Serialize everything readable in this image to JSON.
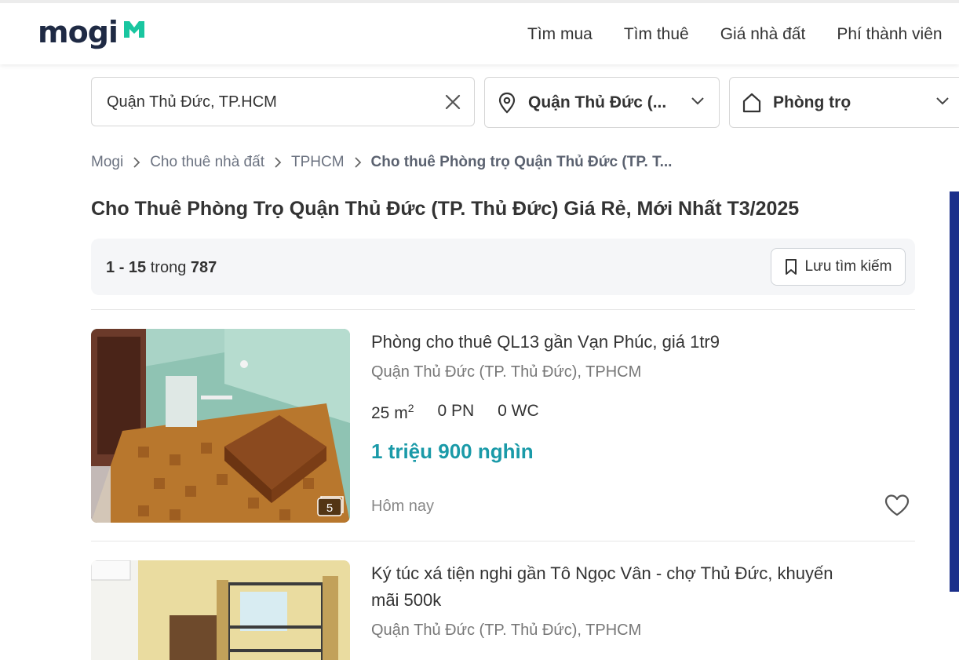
{
  "header": {
    "logo": "mogi",
    "nav": [
      "Tìm mua",
      "Tìm thuê",
      "Giá nhà đất",
      "Phí thành viên"
    ]
  },
  "search": {
    "query": "Quận Thủ Đức, TP.HCM",
    "location": "Quận Thủ Đức (...",
    "property_type": "Phòng trọ"
  },
  "breadcrumb": [
    "Mogi",
    "Cho thuê nhà đất",
    "TPHCM",
    "Cho thuê Phòng trọ Quận Thủ Đức (TP. T..."
  ],
  "page_title": "Cho Thuê Phòng Trọ Quận Thủ Đức (TP. Thủ Đức) Giá Rẻ, Mới Nhất T3/2025",
  "results": {
    "range_start": "1",
    "dash": "-",
    "range_end": "15",
    "in_word": "trong",
    "total": "787",
    "save_search_label": "Lưu tìm kiếm"
  },
  "listings": [
    {
      "title": "Phòng cho thuê QL13 gần Vạn Phúc, giá 1tr9",
      "location": "Quận Thủ Đức (TP. Thủ Đức), TPHCM",
      "area": "25 m",
      "area_sup": "2",
      "bedrooms": "0 PN",
      "bathrooms": "0 WC",
      "price": "1 triệu 900 nghìn",
      "posted": "Hôm nay",
      "photo_count": "5"
    },
    {
      "title": "Ký túc xá tiện nghi gần Tô Ngọc Vân - chợ Thủ Đức, khuyến mãi 500k",
      "location": "Quận Thủ Đức (TP. Thủ Đức), TPHCM"
    }
  ],
  "colors": {
    "brand_dark": "#1f2a44",
    "brand_accent": "#19c6a0",
    "price": "#1a9aa8"
  },
  "icons": [
    "close-icon",
    "location-pin-icon",
    "chevron-down-icon",
    "home-icon",
    "chevron-right-icon",
    "bookmark-icon",
    "camera-icon",
    "heart-icon"
  ]
}
